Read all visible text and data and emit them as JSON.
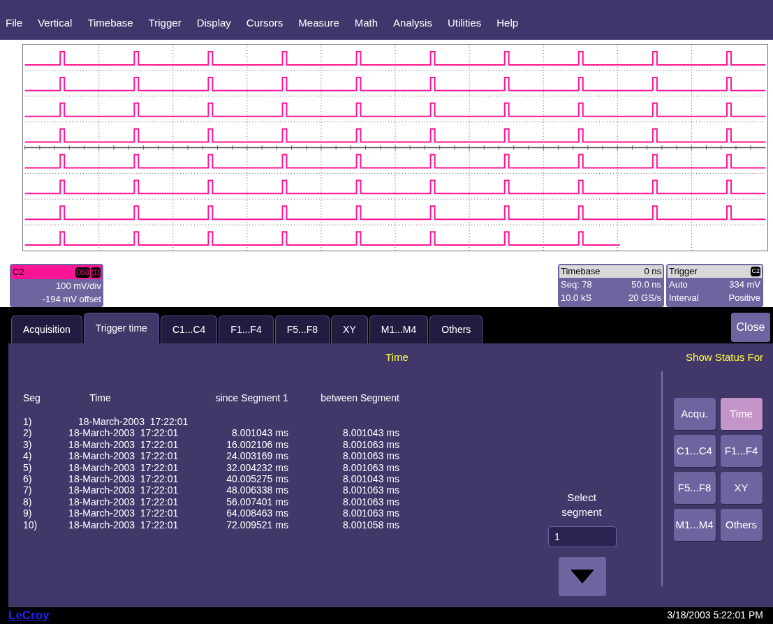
{
  "menu": [
    "File",
    "Vertical",
    "Timebase",
    "Trigger",
    "Display",
    "Cursors",
    "Measure",
    "Math",
    "Analysis",
    "Utilities",
    "Help"
  ],
  "channel_box": {
    "label": "C2",
    "badges": [
      "D50",
      "(1)"
    ],
    "lines": [
      "100 mV/div",
      "-194 mV offset"
    ]
  },
  "timebase_box": {
    "title": "Timebase",
    "value": "0 ns",
    "rows": [
      [
        "Seq: 78",
        "50.0 ns"
      ],
      [
        "10.0 kS",
        "20 GS/s"
      ]
    ]
  },
  "trigger_box": {
    "title": "Trigger",
    "badge": "C2",
    "rows": [
      [
        "Auto",
        "334 mV"
      ],
      [
        "Interval",
        "Positive"
      ]
    ]
  },
  "tabs": [
    {
      "label": "Acquisition",
      "selected": false
    },
    {
      "label": "Trigger time",
      "selected": true
    },
    {
      "label": "C1...C4",
      "selected": false
    },
    {
      "label": "F1...F4",
      "selected": false
    },
    {
      "label": "F5...F8",
      "selected": false
    },
    {
      "label": "XY",
      "selected": false
    },
    {
      "label": "M1...M4",
      "selected": false
    },
    {
      "label": "Others",
      "selected": false
    }
  ],
  "close_button": "Close",
  "panel_title": "Time",
  "table": {
    "columns": [
      "Seg",
      "Time",
      "since Segment 1",
      "between Segment"
    ],
    "rows": [
      {
        "seg": "1)",
        "time": "18-March-2003  17:22:01"
      },
      {
        "seg": "2)",
        "time": "18-March-2003  17:22:01",
        "since": "8.001043 ms",
        "between": "8.001043 ms"
      },
      {
        "seg": "3)",
        "time": "18-March-2003  17:22:01",
        "since": "16.002106 ms",
        "between": "8.001063 ms"
      },
      {
        "seg": "4)",
        "time": "18-March-2003  17:22:01",
        "since": "24.003169 ms",
        "between": "8.001063 ms"
      },
      {
        "seg": "5)",
        "time": "18-March-2003  17:22:01",
        "since": "32.004232 ms",
        "between": "8.001063 ms"
      },
      {
        "seg": "6)",
        "time": "18-March-2003  17:22:01",
        "since": "40.005275 ms",
        "between": "8.001043 ms"
      },
      {
        "seg": "7)",
        "time": "18-March-2003  17:22:01",
        "since": "48.006338 ms",
        "between": "8.001063 ms"
      },
      {
        "seg": "8)",
        "time": "18-March-2003  17:22:01",
        "since": "56.007401 ms",
        "between": "8.001063 ms"
      },
      {
        "seg": "9)",
        "time": "18-March-2003  17:22:01",
        "since": "64.008463 ms",
        "between": "8.001063 ms"
      },
      {
        "seg": "10)",
        "time": "18-March-2003  17:22:01",
        "since": "72.009521 ms",
        "between": "8.001058 ms"
      }
    ]
  },
  "select_segment": {
    "label": "Select segment",
    "value": "1"
  },
  "status": {
    "title": "Show Status For",
    "buttons": [
      {
        "label": "Acqu.",
        "selected": false
      },
      {
        "label": "Time",
        "selected": true
      },
      {
        "label": "C1...C4",
        "selected": false
      },
      {
        "label": "F1...F4",
        "selected": false
      },
      {
        "label": "F5...F8",
        "selected": false
      },
      {
        "label": "XY",
        "selected": false
      },
      {
        "label": "M1...M4",
        "selected": false
      },
      {
        "label": "Others",
        "selected": false
      }
    ]
  },
  "footer": {
    "logo": "LeCroy",
    "datetime": "3/18/2003 5:22:01 PM"
  }
}
